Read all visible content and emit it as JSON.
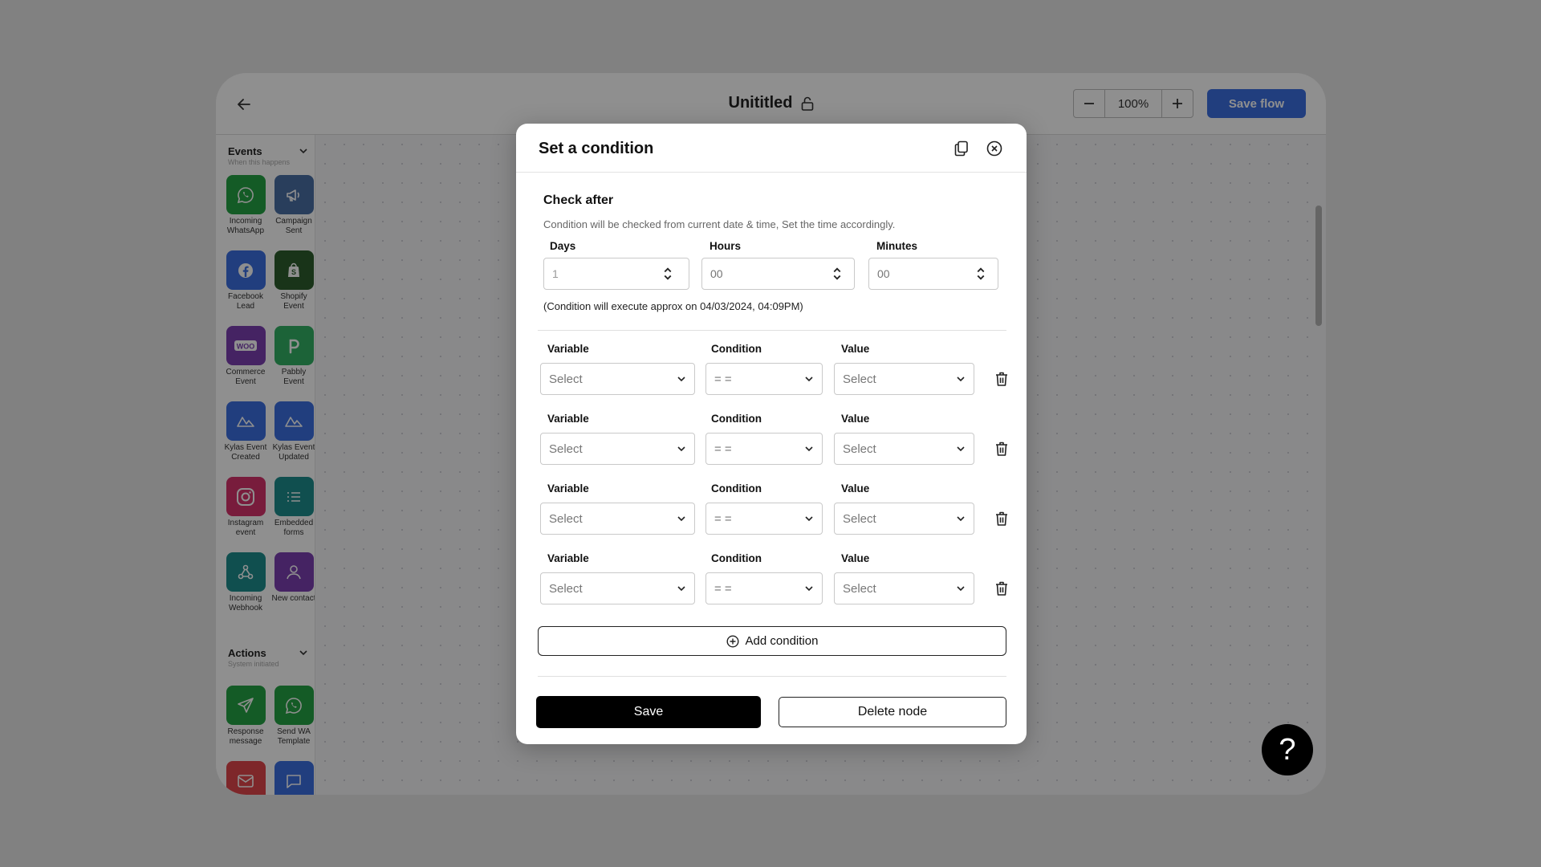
{
  "header": {
    "title": "Unititled",
    "zoom": "100%",
    "save_flow_label": "Save flow"
  },
  "sidebar": {
    "events": {
      "title": "Events",
      "subtitle": "When this happens",
      "items": [
        {
          "label": "Incoming WhatsApp",
          "icon": "whatsapp-icon",
          "color": "#25a244"
        },
        {
          "label": "Campaign Sent",
          "icon": "megaphone-icon",
          "color": "#4a6fa5"
        },
        {
          "label": "Facebook Lead",
          "icon": "facebook-icon",
          "color": "#3b6fe0"
        },
        {
          "label": "Shopify Event",
          "icon": "shopify-icon",
          "color": "#2e5e2e"
        },
        {
          "label": "Commerce Event",
          "icon": "woo-icon",
          "color": "#7b3fb0"
        },
        {
          "label": "Pabbly Event",
          "icon": "pabbly-icon",
          "color": "#33b065"
        },
        {
          "label": "Kylas Event Created",
          "icon": "kylas-icon",
          "color": "#3b6fe0"
        },
        {
          "label": "Kylas Event Updated",
          "icon": "kylas-icon",
          "color": "#3b6fe0"
        },
        {
          "label": "Instagram event",
          "icon": "instagram-icon",
          "color": "#d6336c"
        },
        {
          "label": "Embedded forms",
          "icon": "list-icon",
          "color": "#1e8e8e"
        },
        {
          "label": "Incoming Webhook",
          "icon": "webhook-icon",
          "color": "#1e8e8e"
        },
        {
          "label": "New contact",
          "icon": "user-icon",
          "color": "#7b3fb0"
        }
      ]
    },
    "actions": {
      "title": "Actions",
      "subtitle": "System initiated",
      "items": [
        {
          "label": "Response message",
          "icon": "send-icon",
          "color": "#25a244"
        },
        {
          "label": "Send WA Template",
          "icon": "whatsapp-icon",
          "color": "#25a244"
        },
        {
          "label": "",
          "icon": "mail-icon",
          "color": "#e0474c"
        },
        {
          "label": "",
          "icon": "chat-icon",
          "color": "#3b6fe0"
        }
      ]
    }
  },
  "modal": {
    "title": "Set a condition",
    "check_after": {
      "title": "Check after",
      "description": "Condition will be checked from current date & time, Set the time accordingly.",
      "days_label": "Days",
      "days_value": "1",
      "hours_label": "Hours",
      "hours_placeholder": "00",
      "minutes_label": "Minutes",
      "minutes_placeholder": "00",
      "execute_note": "(Condition will execute approx on 04/03/2024, 04:09PM)"
    },
    "conditions": [
      {
        "variable_label": "Variable",
        "variable": "Select",
        "condition_label": "Condition",
        "condition": "= =",
        "value_label": "Value",
        "value": "Select"
      },
      {
        "variable_label": "Variable",
        "variable": "Select",
        "condition_label": "Condition",
        "condition": "= =",
        "value_label": "Value",
        "value": "Select"
      },
      {
        "variable_label": "Variable",
        "variable": "Select",
        "condition_label": "Condition",
        "condition": "= =",
        "value_label": "Value",
        "value": "Select"
      },
      {
        "variable_label": "Variable",
        "variable": "Select",
        "condition_label": "Condition",
        "condition": "= =",
        "value_label": "Value",
        "value": "Select"
      }
    ],
    "add_condition_label": "Add condition",
    "save_label": "Save",
    "delete_label": "Delete node"
  },
  "help": {
    "label": "?"
  },
  "colors": {
    "accent": "#3b6fe0",
    "primary_button": "#000000"
  }
}
